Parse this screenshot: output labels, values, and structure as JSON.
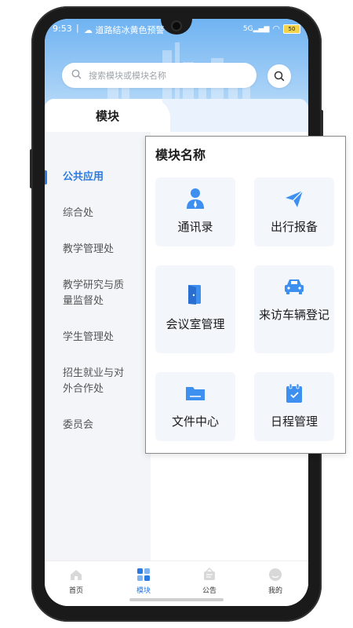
{
  "status_bar": {
    "time": "9:53",
    "separator": "|",
    "alert": "道路结冰黄色预警",
    "network": "5G",
    "battery": "50"
  },
  "search": {
    "placeholder": "搜索模块或模块名称"
  },
  "tabs": {
    "active": "模块"
  },
  "sidebar": {
    "items": [
      {
        "label": "公共应用",
        "active": true
      },
      {
        "label": "综合处"
      },
      {
        "label": "教学管理处"
      },
      {
        "label": "教学研究与质量监督处"
      },
      {
        "label": "学生管理处"
      },
      {
        "label": "招生就业与对外合作处"
      },
      {
        "label": "委员会"
      }
    ]
  },
  "popup": {
    "title": "模块名称",
    "cards": [
      {
        "label": "通讯录",
        "icon": "contact-person-icon"
      },
      {
        "label": "出行报备",
        "icon": "paper-plane-icon"
      },
      {
        "label": "会议室管理",
        "icon": "door-icon"
      },
      {
        "label": "来访车辆登记",
        "icon": "car-icon"
      },
      {
        "label": "文件中心",
        "icon": "folder-icon"
      },
      {
        "label": "日程管理",
        "icon": "calendar-icon"
      }
    ]
  },
  "tabbar": {
    "items": [
      {
        "label": "首页",
        "icon": "home-icon"
      },
      {
        "label": "模块",
        "icon": "grid-icon",
        "active": true
      },
      {
        "label": "公告",
        "icon": "notice-icon"
      },
      {
        "label": "我的",
        "icon": "profile-icon"
      }
    ]
  },
  "colors": {
    "accent": "#2a7ae2",
    "icon_blue": "#3d8ff0",
    "card_bg": "#f3f6fb"
  }
}
